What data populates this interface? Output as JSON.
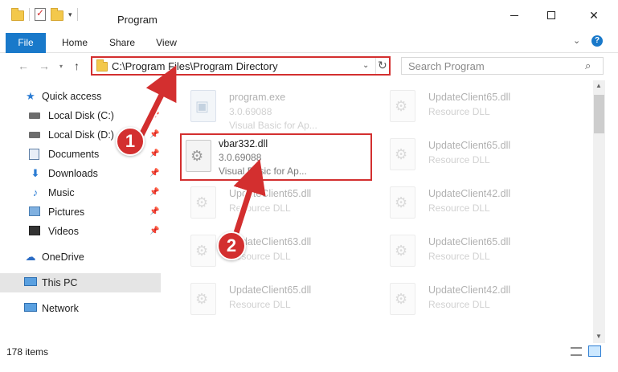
{
  "window": {
    "title": "Program",
    "controls": {
      "minimize": "minimize",
      "maximize": "maximize",
      "close": "✕"
    }
  },
  "ribbon": {
    "tabs": [
      {
        "label": "File"
      },
      {
        "label": "Home"
      },
      {
        "label": "Share"
      },
      {
        "label": "View"
      }
    ],
    "help": "?"
  },
  "nav": {
    "address": "C:\\Program Files\\Program Directory",
    "search_placeholder": "Search Program"
  },
  "sidebar": {
    "items": [
      {
        "label": "Quick access",
        "icon": "star-icon"
      },
      {
        "label": "Local Disk (C:)",
        "icon": "drive-icon",
        "pinned": true
      },
      {
        "label": "Local Disk (D:)",
        "icon": "drive-icon",
        "pinned": true
      },
      {
        "label": "Documents",
        "icon": "documents-icon",
        "pinned": true
      },
      {
        "label": "Downloads",
        "icon": "download-icon",
        "pinned": true
      },
      {
        "label": "Music",
        "icon": "music-icon",
        "pinned": true
      },
      {
        "label": "Pictures",
        "icon": "pictures-icon",
        "pinned": true
      },
      {
        "label": "Videos",
        "icon": "videos-icon",
        "pinned": true
      },
      {
        "label": "OneDrive",
        "icon": "cloud-icon"
      },
      {
        "label": "This PC",
        "icon": "computer-icon"
      },
      {
        "label": "Network",
        "icon": "network-icon"
      }
    ]
  },
  "files": {
    "left": [
      {
        "name": "program.exe",
        "version": "3.0.69088",
        "desc": "Visual Basic for Ap..."
      },
      {
        "name": "vbar332.dll",
        "version": "3.0.69088",
        "desc": "Visual Basic for Ap..."
      },
      {
        "name": "UpdateClient65.dll",
        "version": "Resource DLL",
        "desc": ""
      },
      {
        "name": "UpdateClient63.dll",
        "version": "Resource DLL",
        "desc": ""
      },
      {
        "name": "UpdateClient65.dll",
        "version": "Resource DLL",
        "desc": ""
      }
    ],
    "right": [
      {
        "name": "UpdateClient65.dll",
        "version": "Resource DLL"
      },
      {
        "name": "UpdateClient65.dll",
        "version": "Resource DLL"
      },
      {
        "name": "UpdateClient42.dll",
        "version": "Resource DLL"
      },
      {
        "name": "UpdateClient65.dll",
        "version": "Resource DLL"
      },
      {
        "name": "UpdateClient42.dll",
        "version": "Resource DLL"
      }
    ]
  },
  "status": {
    "items": "178 items"
  },
  "callouts": {
    "one": "1",
    "two": "2"
  },
  "colors": {
    "accent": "#1979ca",
    "highlight": "#d32f2f",
    "selection": "#cce8ff"
  }
}
